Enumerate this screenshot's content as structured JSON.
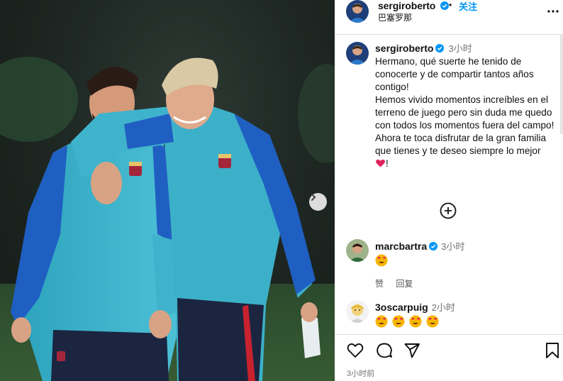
{
  "post": {
    "author": "sergiroberto",
    "location": "巴塞罗那",
    "follow_label": "关注",
    "separator": "•",
    "caption_time": "3小时",
    "caption_text": "Hermano, qué suerte he tenido de conocerte y de compartir tantos años contigo!\nHemos vivido momentos increíbles en el terreno de juego pero sin duda me quedo con todos los momentos fuera del campo! Ahora te toca disfrutar de la gran familia que tienes y te deseo siempre lo mejor",
    "caption_tail": "!",
    "posted_ago": "3小时前"
  },
  "comments": [
    {
      "user": "marcbartra",
      "verified": true,
      "time": "3小时",
      "emoji_count": 1,
      "like_label": "赞",
      "reply_label": "回复"
    },
    {
      "user": "3oscarpuig",
      "verified": false,
      "time": "2小时",
      "emoji_count": 4
    }
  ],
  "icons": {
    "verified": "verified-badge-icon",
    "more": "more-options-icon",
    "load_more": "plus-circle-icon",
    "like": "heart-outline-icon",
    "comment": "comment-bubble-icon",
    "share": "paper-plane-icon",
    "save": "bookmark-icon",
    "carousel_next": "chevron-right-icon"
  },
  "colors": {
    "accent_blue": "#0095f6",
    "verified_blue": "#0095f6",
    "muted_text": "#737373",
    "divider": "#dbdbdb",
    "heart_red": "#e0245e",
    "jersey_cyan": "#3fb3cc",
    "jersey_blue": "#1f5fc2"
  }
}
